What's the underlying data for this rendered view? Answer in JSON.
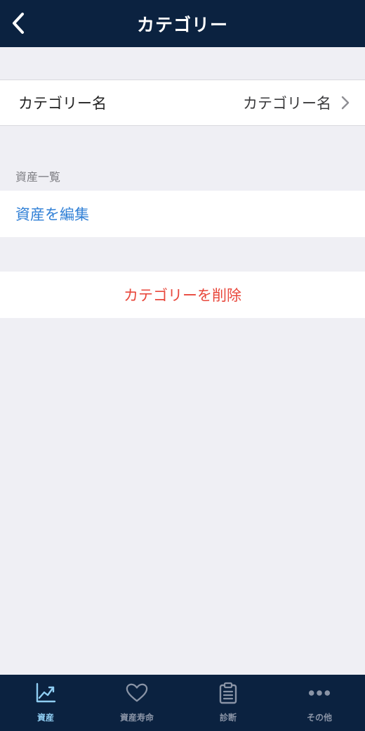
{
  "navbar": {
    "title": "カテゴリー",
    "back_icon": "chevron-left-icon"
  },
  "category_cell": {
    "label": "カテゴリー名",
    "value": "カテゴリー名",
    "chevron_icon": "chevron-right-icon"
  },
  "assets_section": {
    "header": "資産一覧",
    "edit_label": "資産を編集"
  },
  "delete_label": "カテゴリーを削除",
  "tabbar": {
    "active_color": "#8fcdf2",
    "inactive_color": "#8a94a6",
    "items": [
      {
        "label": "資産",
        "icon": "chart-line-icon",
        "active": true
      },
      {
        "label": "資産寿命",
        "icon": "heart-icon",
        "active": false
      },
      {
        "label": "診断",
        "icon": "clipboard-icon",
        "active": false
      },
      {
        "label": "その他",
        "icon": "more-dots-icon",
        "active": false
      }
    ]
  },
  "colors": {
    "nav_bg": "#0b2240",
    "link_blue": "#2f7fd6",
    "destructive_red": "#e8473b",
    "background": "#efeff4"
  }
}
